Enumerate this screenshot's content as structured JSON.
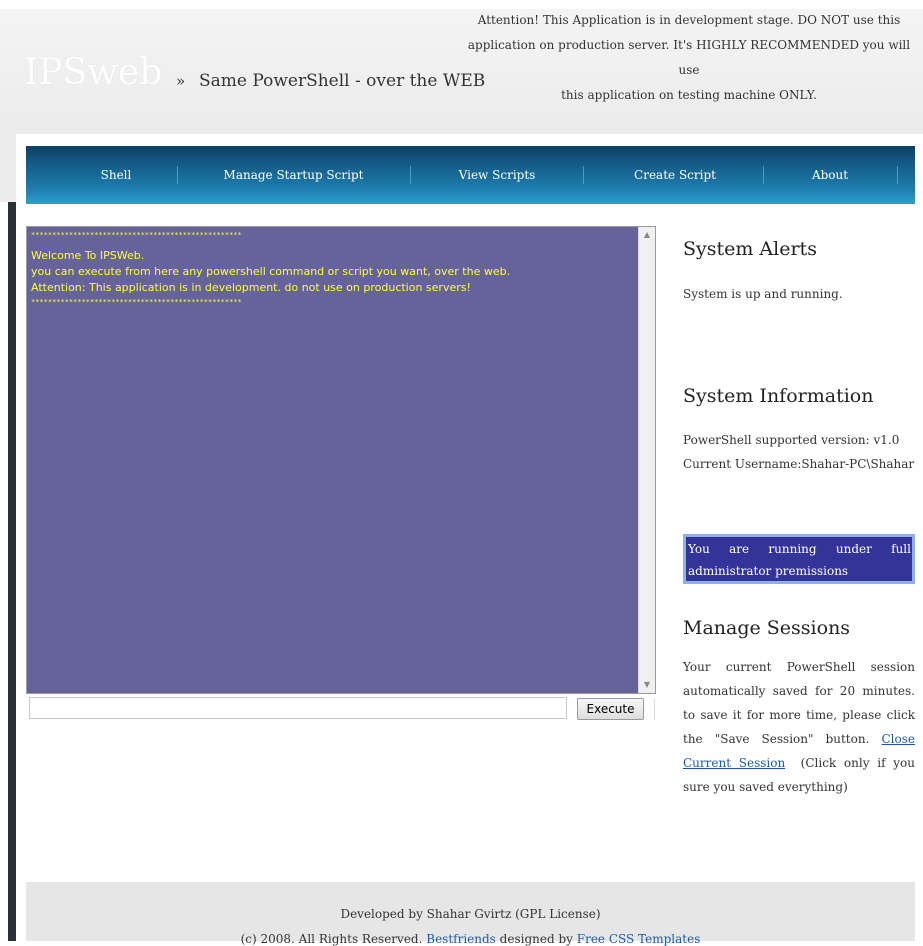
{
  "header": {
    "logo": "IPSweb",
    "separator": "»",
    "tagline": "Same PowerShell - over the WEB",
    "notice_line1": "Attention! This Application is in development stage. DO NOT use this",
    "notice_line2": "application on production server. It's HIGHLY RECOMMENDED you will use",
    "notice_line3": "this application on testing machine ONLY."
  },
  "nav": {
    "items": [
      {
        "label": "Shell"
      },
      {
        "label": "Manage Startup Script"
      },
      {
        "label": "View Scripts"
      },
      {
        "label": "Create Script"
      },
      {
        "label": "About"
      }
    ]
  },
  "console": {
    "stars": "**************************************************",
    "line1": "Welcome To IPSWeb.",
    "line2": "you can execute from here any powershell command or script you want, over the web.",
    "line3": "Attention: This application is in development. do not use on production servers!",
    "input_value": "",
    "execute_label": "Execute"
  },
  "sidebar": {
    "alerts_title": "System Alerts",
    "alerts_text": "System is up and running.",
    "info_title": "System Information",
    "info_version": "PowerShell supported version: v1.0",
    "info_user": "Current Username:Shahar-PC\\Shahar",
    "admin_words": [
      "You",
      "are",
      "running",
      "under",
      "full"
    ],
    "admin_line2": "administrator premissions",
    "sessions_title": "Manage Sessions",
    "sessions_text": "Your current PowerShell session automatically saved for 20 minutes. to save it for more time, please click the \"Save Session\" button.",
    "close_link": "Close Current Session",
    "close_note": "(Click only if you sure you saved everything)"
  },
  "footer": {
    "line1": "Developed by Shahar Gvirtz (GPL License)",
    "line2_prefix": "(c) 2008. All Rights Reserved.",
    "line2_link1": "Bestfriends",
    "line2_mid": "designed by",
    "line2_link2": "Free CSS Templates"
  },
  "colors": {
    "console_bg": "#66639a",
    "console_text": "#ffff33",
    "nav_top": "#0d3f63",
    "nav_bottom": "#2aa0cf",
    "admin_box_bg": "#33339a",
    "link": "#1a5aa8"
  },
  "icons": {
    "scroll_up": "scroll-up-icon",
    "scroll_down": "scroll-down-icon"
  }
}
